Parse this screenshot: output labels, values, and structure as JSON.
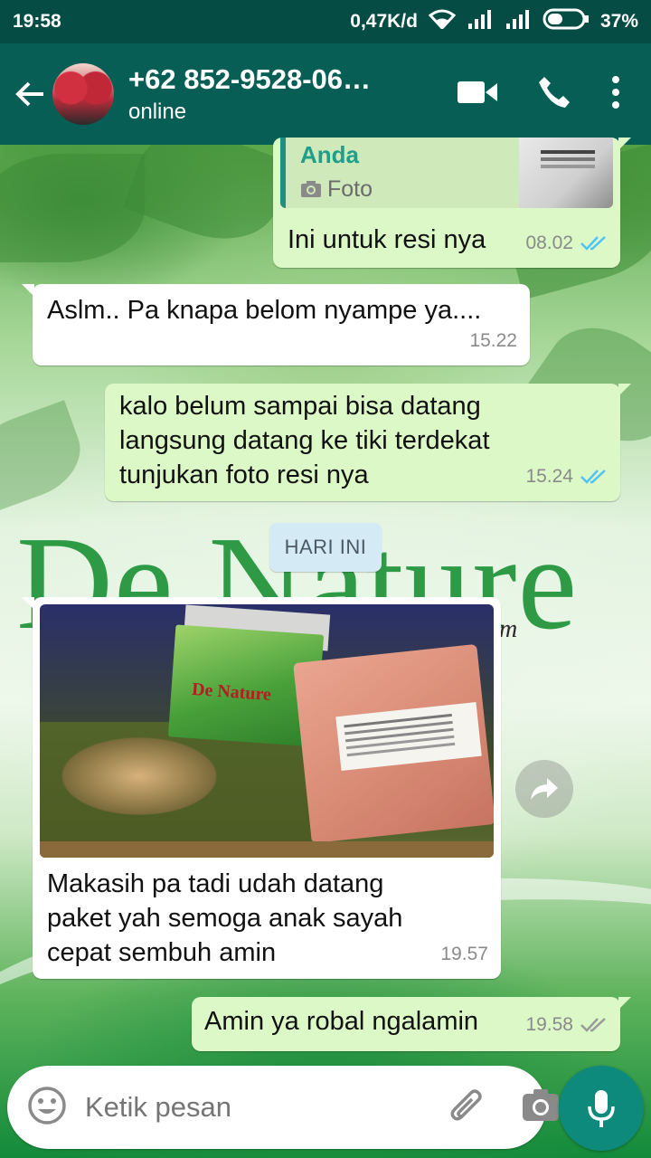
{
  "status_bar": {
    "time": "19:58",
    "network_speed": "0,47K/d",
    "battery": "37%"
  },
  "header": {
    "contact_name": "+62 852-9528-06…",
    "status": "online"
  },
  "background": {
    "brand_text": "De Nature",
    "brand_suffix": "m"
  },
  "messages": [
    {
      "direction": "outgoing",
      "quote": {
        "author": "Anda",
        "type": "Foto"
      },
      "text": "Ini untuk resi nya",
      "time": "08.02",
      "ticks": "read"
    },
    {
      "direction": "incoming",
      "text": "Aslm.. Pa knapa belom nyampe ya....",
      "time": "15.22"
    },
    {
      "direction": "outgoing",
      "lines": [
        "kalo belum sampai bisa datang",
        "langsung datang ke tiki terdekat",
        "tunjukan foto resi nya"
      ],
      "time": "15.24",
      "ticks": "read"
    },
    {
      "direction": "incoming",
      "image": {
        "product_label": "De Nature"
      },
      "lines": [
        "Makasih pa tadi udah datang",
        "paket yah semoga anak sayah",
        "cepat sembuh amin"
      ],
      "time": "19.57"
    },
    {
      "direction": "outgoing",
      "text": "Amin ya robal ngalamin",
      "time": "19.58",
      "ticks": "delivered"
    }
  ],
  "day_separator": "HARI INI",
  "composer": {
    "placeholder": "Ketik pesan"
  },
  "colors": {
    "header": "#075e54",
    "outgoing_bubble": "#dcf8c6",
    "incoming_bubble": "#ffffff",
    "read_tick": "#4fc3f7",
    "accent": "#0e8a7c"
  }
}
